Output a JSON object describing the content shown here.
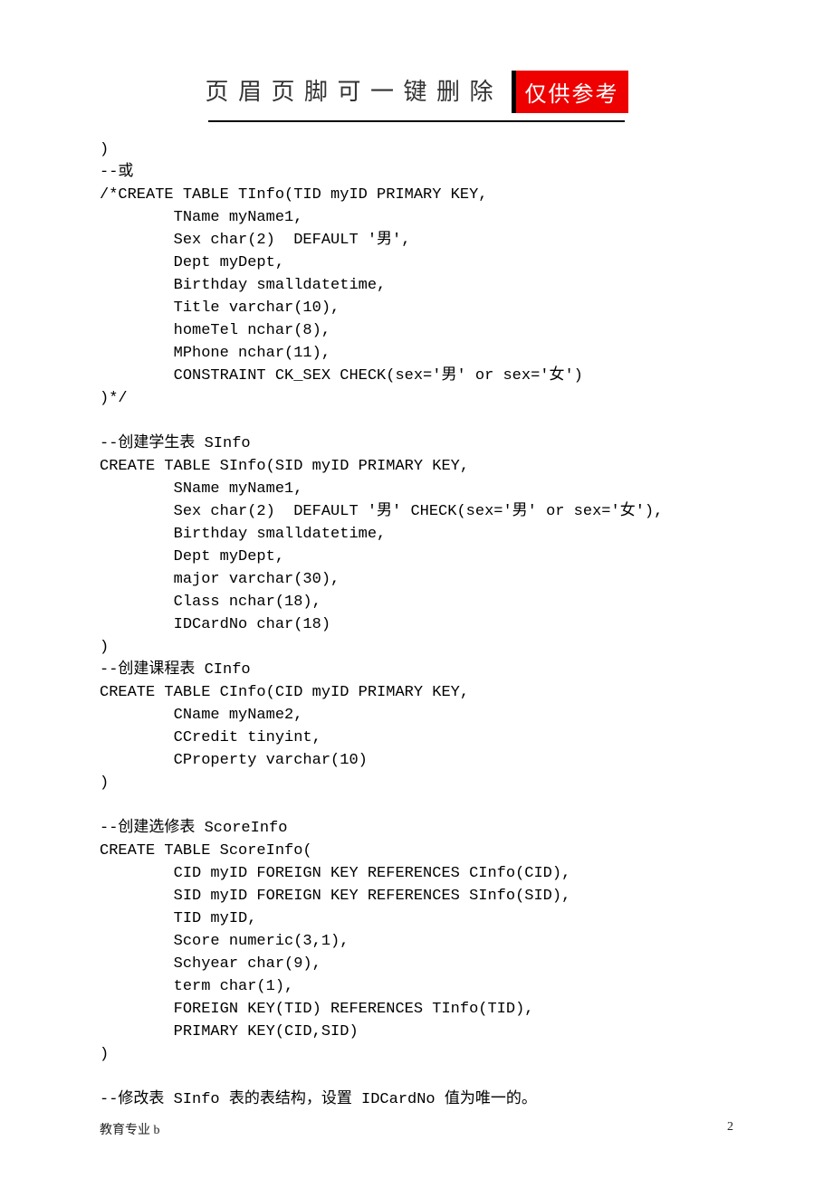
{
  "header": {
    "title": "页 眉 页 脚 可 一 键 删 除",
    "stamp": "仅供参考"
  },
  "code": ")\n--或\n/*CREATE TABLE TInfo(TID myID PRIMARY KEY,\n        TName myName1,\n        Sex char(2)  DEFAULT '男',\n        Dept myDept,\n        Birthday smalldatetime,\n        Title varchar(10),\n        homeTel nchar(8),\n        MPhone nchar(11),\n        CONSTRAINT CK_SEX CHECK(sex='男' or sex='女')\n)*/\n\n--创建学生表 SInfo\nCREATE TABLE SInfo(SID myID PRIMARY KEY,\n        SName myName1,\n        Sex char(2)  DEFAULT '男' CHECK(sex='男' or sex='女'),\n        Birthday smalldatetime,\n        Dept myDept,\n        major varchar(30),\n        Class nchar(18),\n        IDCardNo char(18)\n)\n--创建课程表 CInfo\nCREATE TABLE CInfo(CID myID PRIMARY KEY,\n        CName myName2,\n        CCredit tinyint,\n        CProperty varchar(10)\n)\n\n--创建选修表 ScoreInfo\nCREATE TABLE ScoreInfo(\n        CID myID FOREIGN KEY REFERENCES CInfo(CID),\n        SID myID FOREIGN KEY REFERENCES SInfo(SID),\n        TID myID,\n        Score numeric(3,1),\n        Schyear char(9),\n        term char(1),\n        FOREIGN KEY(TID) REFERENCES TInfo(TID),\n        PRIMARY KEY(CID,SID)\n)\n\n--修改表 SInfo 表的表结构，设置 IDCardNo 值为唯一的。",
  "footer": {
    "left": "教育专业 b",
    "right": "2"
  }
}
